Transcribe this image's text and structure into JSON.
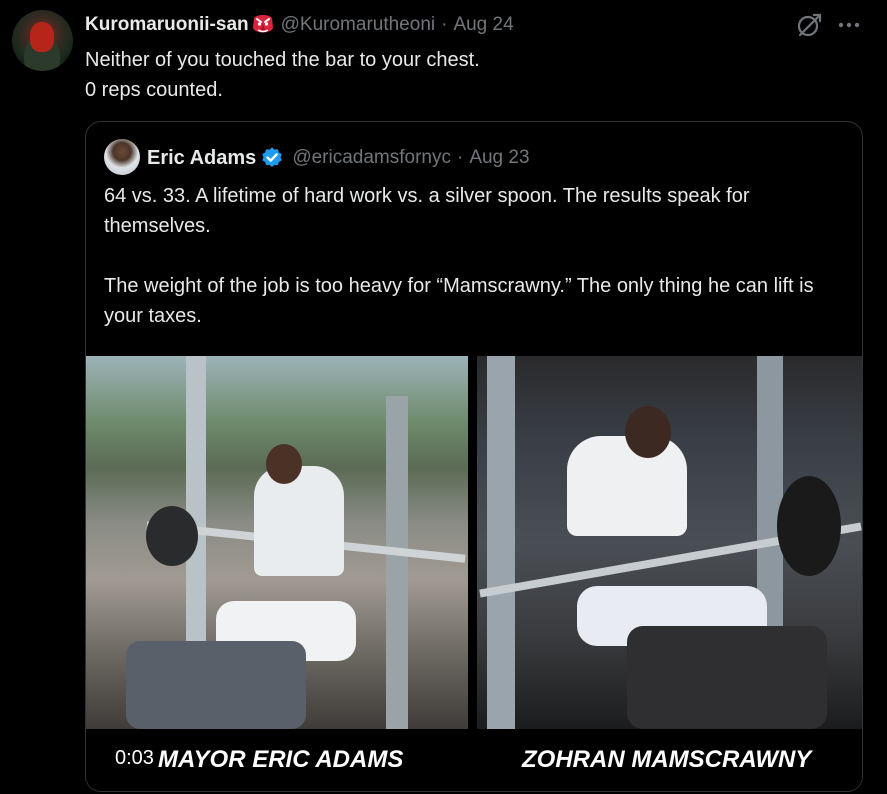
{
  "tweet": {
    "display_name": "Kuromaruonii-san",
    "handle": "@Kuromarutheoni",
    "separator": "·",
    "date": "Aug 24",
    "text": "Neither of you touched the bar to your chest.\n0 reps counted."
  },
  "quoted_tweet": {
    "display_name": "Eric Adams",
    "handle": "@ericadamsfornyc",
    "separator": "·",
    "date": "Aug 23",
    "text": "64 vs. 33. A lifetime of hard work vs. a silver spoon. The results speak for themselves.\n\nThe weight of the job is too heavy for “Mamscrawny.” The only thing he can lift is your taxes."
  },
  "video": {
    "timestamp": "0:03",
    "left_caption": "MAYOR ERIC ADAMS",
    "right_caption": "ZOHRAN MAMSCRAWNY"
  },
  "icons": {
    "emoji_badge": "tengu-mask-emoji",
    "verified": "verified-badge-icon",
    "grok": "grok-icon",
    "more": "more-icon"
  },
  "colors": {
    "background": "#000000",
    "text_primary": "#e7e9ea",
    "text_secondary": "#71767b",
    "border": "#2f3336",
    "verified_blue": "#1d9bf0",
    "emoji_red": "#d7263d"
  }
}
